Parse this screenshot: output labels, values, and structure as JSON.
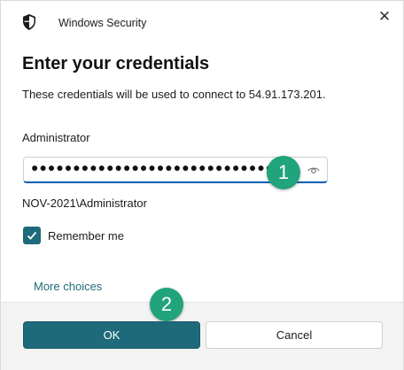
{
  "window": {
    "app_title": "Windows Security",
    "close_glyph": "✕"
  },
  "main": {
    "heading": "Enter your credentials",
    "subtext": "These credentials will be used to connect to 54.91.173.201.",
    "username": "Administrator",
    "password_masked": "●●●●●●●●●●●●●●●●●●●●●●●●●●●●●●●",
    "domain_user": "NOV-2021\\Administrator",
    "remember_me": {
      "label": "Remember me",
      "checked": true
    },
    "more_choices": "More choices"
  },
  "markers": [
    "1",
    "2"
  ],
  "buttons": {
    "ok": "OK",
    "cancel": "Cancel"
  },
  "icons": {
    "app": "shield-icon",
    "close": "close-icon",
    "reveal": "eye-icon",
    "check": "checkmark-icon"
  },
  "colors": {
    "accent": "#1e6a7b",
    "focus_underline": "#005fb8",
    "marker": "#21a37b"
  }
}
